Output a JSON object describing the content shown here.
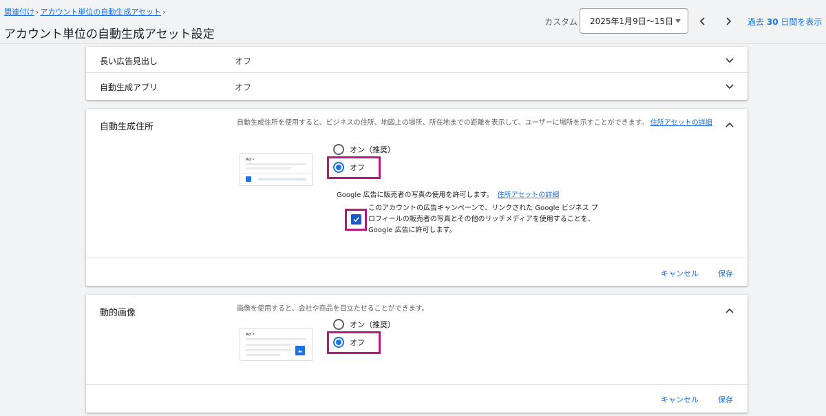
{
  "header": {
    "breadcrumb": [
      "関連付け",
      "アカウント単位の自動生成アセット"
    ],
    "title": "アカウント単位の自動生成アセット設定",
    "date_label": "カスタム",
    "date_range": "2025年1月9日～15日",
    "show_30_prefix": "過去",
    "show_30_num": "30",
    "show_30_suffix": "日間を表示"
  },
  "collapsed_rows": [
    {
      "title": "長い広告見出し",
      "value": "オフ"
    },
    {
      "title": "自動生成アプリ",
      "value": "オフ"
    }
  ],
  "location": {
    "title": "自動生成住所",
    "description": "自動生成住所を使用すると、ビジネスの住所、地図上の場所、所在地までの距離を表示して、ユーザーに場所を示すことができます。",
    "link": "住所アセットの詳細",
    "option_on": "オン（推奨）",
    "option_off": "オフ",
    "selected": "off",
    "photo_text": "Google 広告に販売者の写真の使用を許可します。",
    "photo_link": "住所アセットの詳細",
    "checkbox_text": "このアカウントの広告キャンペーンで、リンクされた Google ビジネス プロフィールの販売者の写真とその他のリッチメディアを使用することを、Google 広告に許可します。",
    "checkbox_checked": true,
    "cancel": "キャンセル",
    "save": "保存",
    "illus_ad": "Ad •"
  },
  "dynamic_image": {
    "title": "動的画像",
    "description": "画像を使用すると、会社や商品を目立たせることができます。",
    "option_on": "オン（推奨）",
    "option_off": "オフ",
    "selected": "off",
    "cancel": "キャンセル",
    "save": "保存",
    "illus_ad": "Ad •"
  },
  "colors": {
    "accent": "#1a73e8",
    "highlight": "#b5187e"
  }
}
